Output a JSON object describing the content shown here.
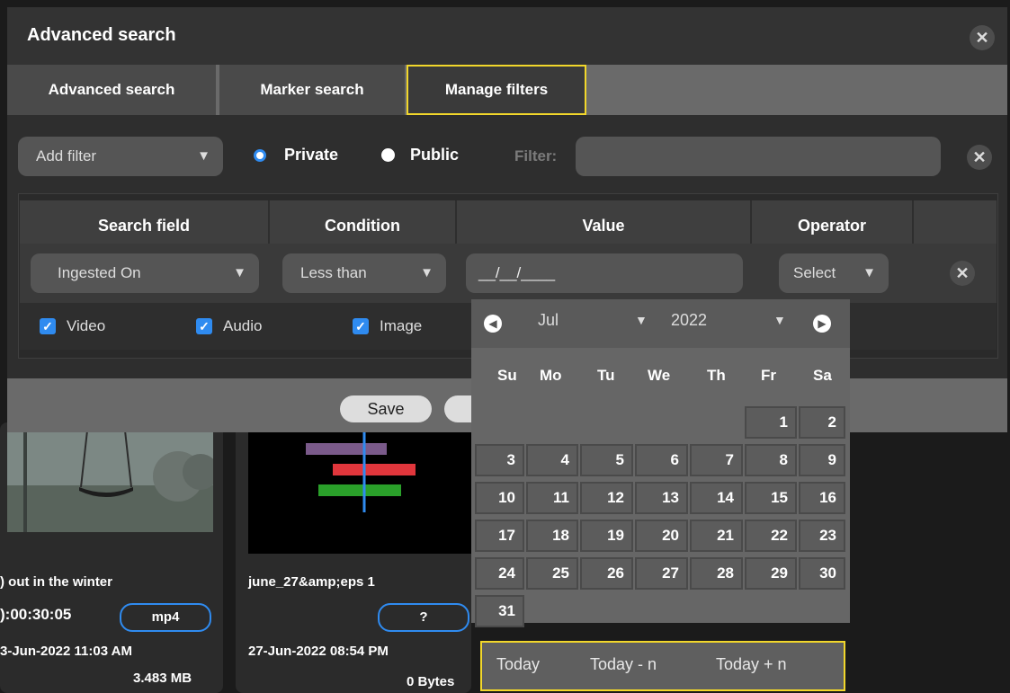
{
  "dialog": {
    "title": "Advanced search",
    "close_icon": "close-icon",
    "tabs": [
      {
        "label": "Advanced search"
      },
      {
        "label": "Marker search"
      },
      {
        "label": "Manage filters"
      }
    ],
    "add_filter": {
      "value": "Add filter"
    },
    "visibility": {
      "private": "Private",
      "public": "Public",
      "selected": "Private"
    },
    "filter": {
      "label": "Filter:",
      "value": ""
    },
    "columns": [
      "Search field",
      "Condition",
      "Value",
      "Operator",
      ""
    ],
    "row": {
      "search_field": "Ingested On",
      "condition": "Less than",
      "value": "__/__/____",
      "operator": "Select"
    },
    "types": [
      {
        "label": "Video",
        "checked": true
      },
      {
        "label": "Audio",
        "checked": true
      },
      {
        "label": "Image",
        "checked": true
      }
    ],
    "save_label": "Save"
  },
  "calendar": {
    "month": "Jul",
    "year": "2022",
    "weekdays": [
      "Su",
      "Mo",
      "Tu",
      "We",
      "Th",
      "Fr",
      "Sa"
    ],
    "weeks": [
      [
        "",
        "",
        "",
        "",
        "",
        "1",
        "2"
      ],
      [
        "3",
        "4",
        "5",
        "6",
        "7",
        "8",
        "9"
      ],
      [
        "10",
        "11",
        "12",
        "13",
        "14",
        "15",
        "16"
      ],
      [
        "17",
        "18",
        "19",
        "20",
        "21",
        "22",
        "23"
      ],
      [
        "24",
        "25",
        "26",
        "27",
        "28",
        "29",
        "30"
      ],
      [
        "31",
        "",
        "",
        "",
        "",
        "",
        ""
      ]
    ],
    "quick": [
      "Today",
      "Today - n",
      "Today + n"
    ]
  },
  "cards": [
    {
      "title": ") out in the winter",
      "duration": "):00:30:05",
      "format": "mp4",
      "date": "3-Jun-2022 11:03 AM",
      "size": "3.483 MB"
    },
    {
      "title": "june_27&amp;eps 1",
      "format": "?",
      "date": "27-Jun-2022 08:54 PM",
      "size": "0 Bytes"
    }
  ],
  "colors": {
    "accent": "#2f8bf0",
    "highlight": "#f2d72b",
    "bar_purple": "#7a5a8a",
    "bar_red": "#e0363c",
    "bar_green": "#2aa02a"
  }
}
